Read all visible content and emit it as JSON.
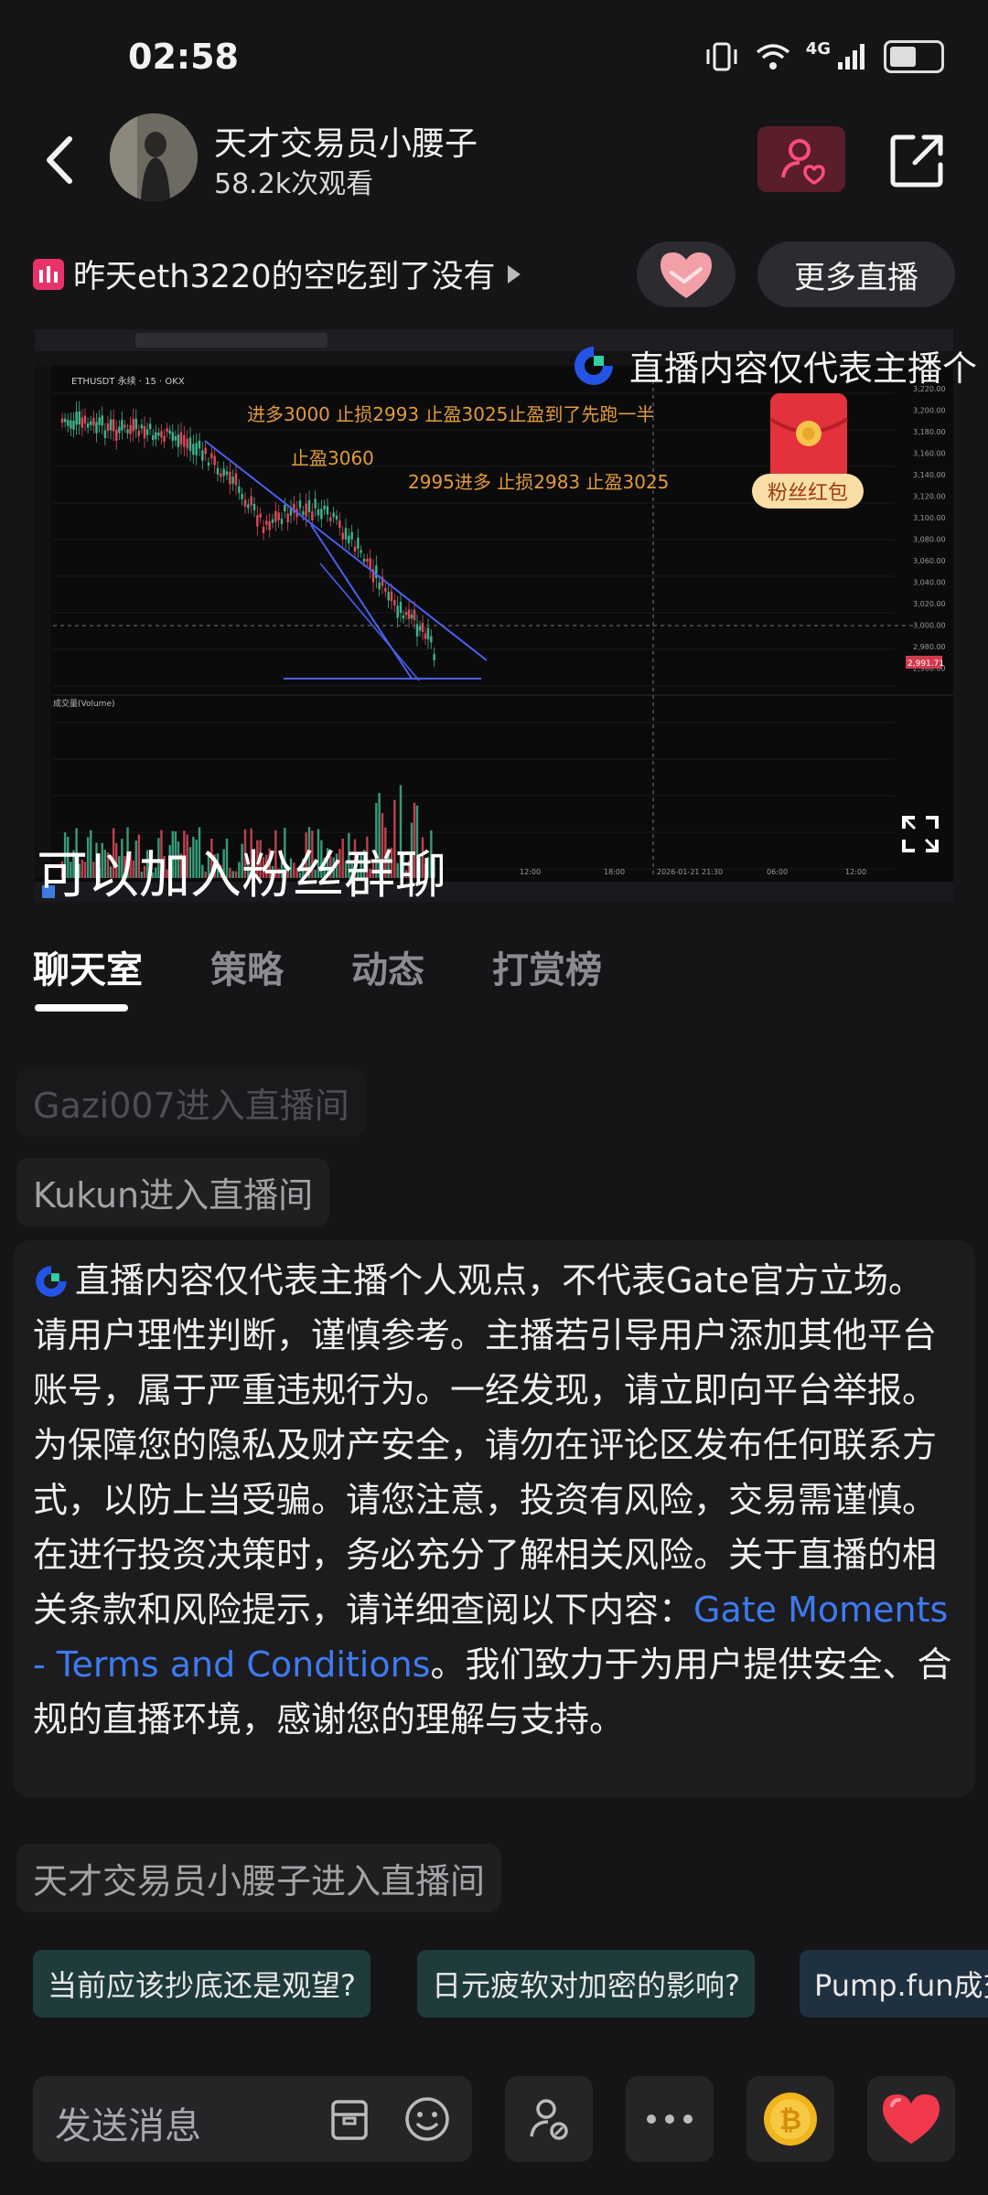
{
  "status_bar": {
    "time": "02:58",
    "network": "4G"
  },
  "header": {
    "host_name": "天才交易员小腰子",
    "viewers": "58.2k次观看"
  },
  "topic": {
    "title": "昨天eth3220的空吃到了没有"
  },
  "buttons": {
    "more_live": "更多直播"
  },
  "video": {
    "overlay_disclaimer": "直播内容仅代表主播个",
    "caption": "可以加入粉丝群聊",
    "red_packet_label": "粉丝红包",
    "chart": {
      "symbol": "ETHUSDT 永续 · 15 · OKX",
      "annotations": [
        "进多3000  止损2993   止盈3025止盈到了先跑一半",
        "止盈3060",
        "2995进多  止损2983  止盈3025"
      ],
      "price_ticks": [
        "3,220.00",
        "3,200.00",
        "3,180.00",
        "3,160.00",
        "3,140.00",
        "3,120.00",
        "3,100.00",
        "3,080.00",
        "3,060.00",
        "3,040.00",
        "3,020.00",
        "3,000.00",
        "2,980.00",
        "2,960.00"
      ],
      "time_ticks": [
        "12:00",
        "18:00",
        "2026-01-21  21:30",
        "06:00",
        "12:00"
      ],
      "volume_label": "成交量(Volume)",
      "current_price": "2,991.71"
    }
  },
  "tabs": [
    {
      "label": "聊天室",
      "active": true
    },
    {
      "label": "策略",
      "active": false
    },
    {
      "label": "动态",
      "active": false
    },
    {
      "label": "打赏榜",
      "active": false
    }
  ],
  "chat": {
    "entry1": "Gazi007进入直播间",
    "entry2": "Kukun进入直播间",
    "notice_main": "直播内容仅代表主播个人观点，不代表Gate官方立场。请用户理性判断，谨慎参考。主播若引导用户添加其他平台账号，属于严重违规行为。一经发现，请立即向平台举报。为保障您的隐私及财产安全，请勿在评论区发布任何联系方式，以防上当受骗。请您注意，投资有风险，交易需谨慎。在进行投资决策时，务必充分了解相关风险。关于直播的相关条款和风险提示，请详细查阅以下内容：",
    "notice_link": "Gate Moments - Terms and Conditions",
    "notice_tail": "。我们致力于为用户提供安全、合规的直播环境，感谢您的理解与支持。",
    "entry3": "天才交易员小腰子进入直播间"
  },
  "quick_questions": [
    "当前应该抄底还是观望?",
    "日元疲软对加密的影响?",
    "Pump.fun成交"
  ],
  "input": {
    "placeholder": "发送消息"
  },
  "colors": {
    "background": "#151517",
    "link": "#3e7bf2",
    "accent_red": "#e8336a",
    "chart_text_orange": "#e39a3b",
    "trendline_blue": "#4a5ff0"
  }
}
